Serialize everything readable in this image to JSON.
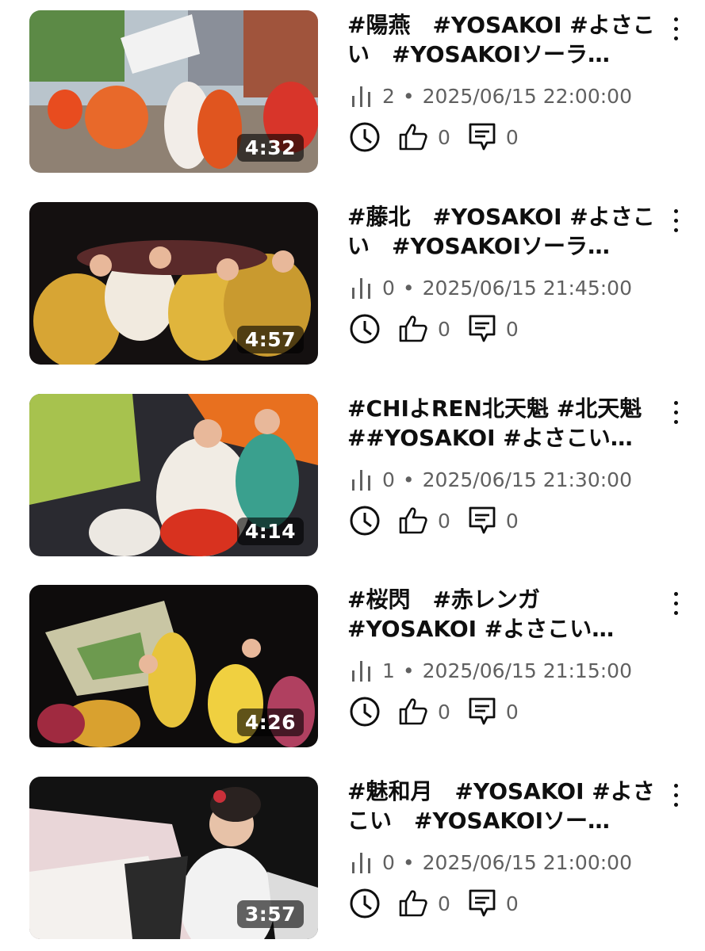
{
  "videos": [
    {
      "title": "#陽燕　#YOSAKOI #よさこい　#YOSAKOIソーラ…",
      "duration": "4:32",
      "views": "2",
      "datetime": "2025/06/15 22:00:00",
      "likes": "0",
      "comments": "0"
    },
    {
      "title": "#藤北　#YOSAKOI #よさこい　#YOSAKOIソーラ…",
      "duration": "4:57",
      "views": "0",
      "datetime": "2025/06/15 21:45:00",
      "likes": "0",
      "comments": "0"
    },
    {
      "title": "#CHIよREN北天魁 #北天魁\n##YOSAKOI #よさこい…",
      "duration": "4:14",
      "views": "0",
      "datetime": "2025/06/15 21:30:00",
      "likes": "0",
      "comments": "0"
    },
    {
      "title": "#桜閃　#赤レンガ\n#YOSAKOI #よさこい…",
      "duration": "4:26",
      "views": "1",
      "datetime": "2025/06/15 21:15:00",
      "likes": "0",
      "comments": "0"
    },
    {
      "title": "#魅和月　#YOSAKOI #よさこい　#YOSAKOIソー…",
      "duration": "3:57",
      "views": "0",
      "datetime": "2025/06/15 21:00:00",
      "likes": "0",
      "comments": "0"
    }
  ],
  "icons": {
    "views": "bar-chart-icon",
    "watch_later": "clock-icon",
    "like": "thumbs-up-icon",
    "comments": "comment-icon",
    "menu": "more-vert-icon"
  }
}
